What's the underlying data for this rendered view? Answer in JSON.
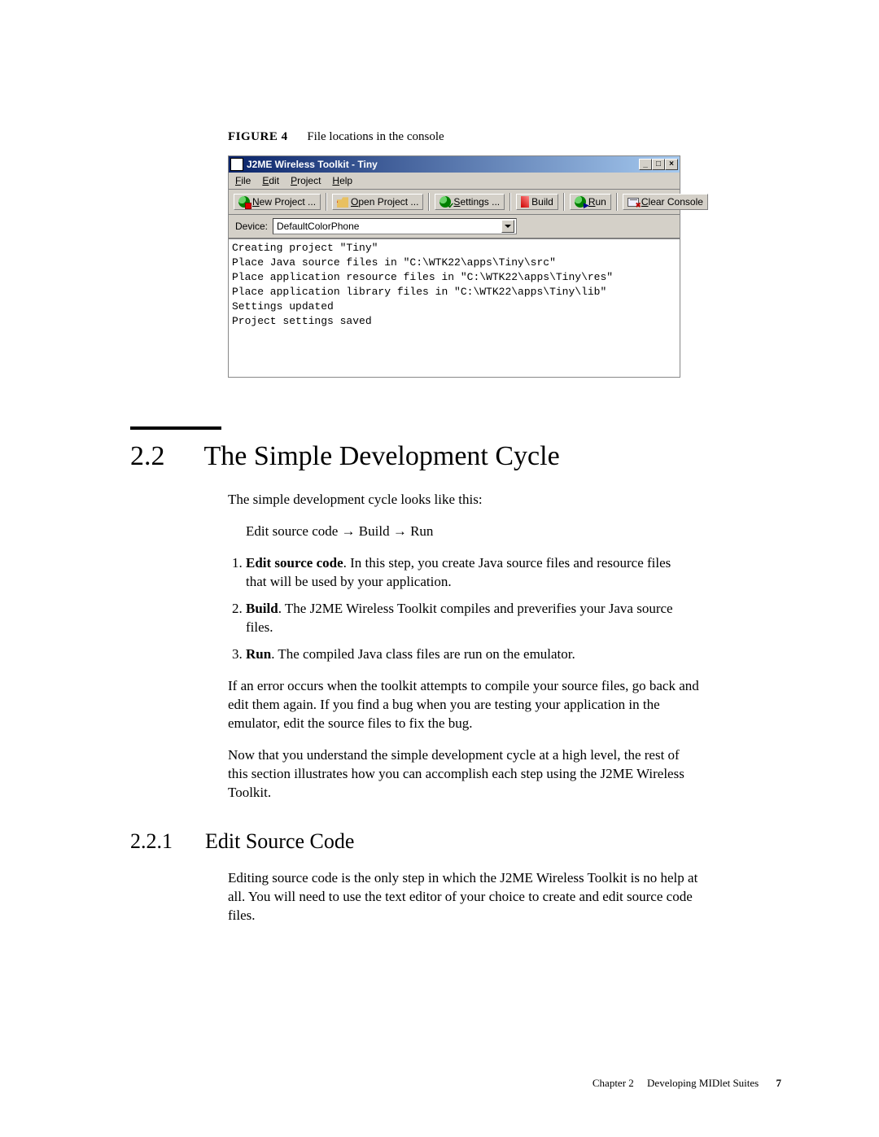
{
  "figure": {
    "label": "FIGURE 4",
    "caption": "File locations in the console"
  },
  "window": {
    "title": "J2ME Wireless Toolkit - Tiny",
    "menus": [
      "File",
      "Edit",
      "Project",
      "Help"
    ],
    "toolbar": {
      "new_project": "New Project ...",
      "open_project": "Open Project ...",
      "settings": "Settings ...",
      "build": "Build",
      "run": "Run",
      "clear_console": "Clear Console"
    },
    "device_label": "Device:",
    "device_value": "DefaultColorPhone",
    "console_lines": [
      "Creating project \"Tiny\"",
      "Place Java source files in \"C:\\WTK22\\apps\\Tiny\\src\"",
      "Place application resource files in \"C:\\WTK22\\apps\\Tiny\\res\"",
      "Place application library files in \"C:\\WTK22\\apps\\Tiny\\lib\"",
      "Settings updated",
      "Project settings saved"
    ]
  },
  "section": {
    "number": "2.2",
    "title": "The Simple Development Cycle",
    "intro": "The simple development cycle looks like this:",
    "flow": "Edit source code → Build → Run",
    "steps": [
      {
        "bold": "Edit source code",
        "text": ". In this step, you create Java source files and resource files that will be used by your application."
      },
      {
        "bold": "Build",
        "text": ". The J2ME Wireless Toolkit compiles and preverifies your Java source files."
      },
      {
        "bold": "Run",
        "text": ". The compiled Java class files are run on the emulator."
      }
    ],
    "para_error": "If an error occurs when the toolkit attempts to compile your source files, go back and edit them again. If you find a bug when you are testing your application in the emulator, edit the source files to fix the bug.",
    "para_transition": "Now that you understand the simple development cycle at a high level, the rest of this section illustrates how you can accomplish each step using the J2ME Wireless Toolkit."
  },
  "subsection": {
    "number": "2.2.1",
    "title": "Edit Source Code",
    "para": "Editing source code is the only step in which the J2ME Wireless Toolkit is no help at all. You will need to use the text editor of your choice to create and edit source code files."
  },
  "footer": {
    "chapter": "Chapter 2",
    "title": "Developing MIDlet Suites",
    "page": "7"
  }
}
